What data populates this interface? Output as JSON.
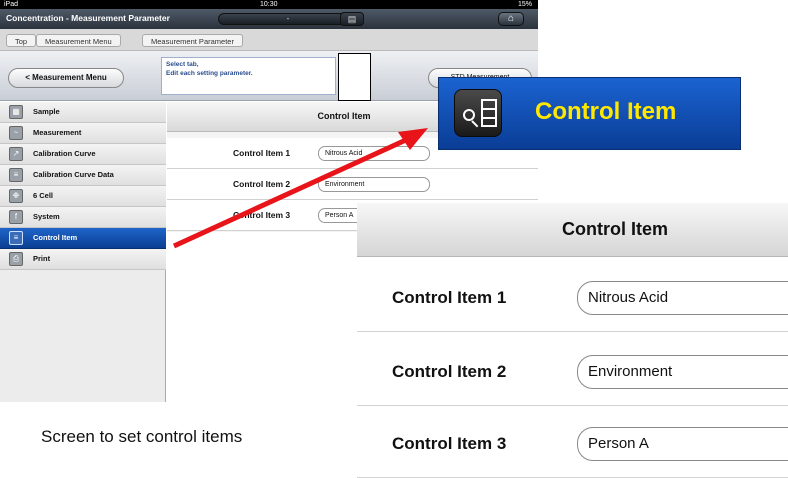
{
  "statusbar": {
    "device": "iPad",
    "time": "10:30",
    "battery": "15%"
  },
  "titlebar": {
    "title": "Concentration - Measurement Parameter",
    "center_label": "-"
  },
  "breadcrumb": [
    "Top",
    "Measurement Menu",
    "Measurement Parameter"
  ],
  "toolbar": {
    "back_label": "< Measurement Menu",
    "message_line1": "Select tab,",
    "message_line2": "Edit each setting parameter.",
    "right_button_label": "STD Measurement"
  },
  "sidebar": {
    "items": [
      {
        "label": "Sample",
        "icon": "sample-icon",
        "selected": false
      },
      {
        "label": "Measurement",
        "icon": "measurement-icon",
        "selected": false
      },
      {
        "label": "Calibration Curve",
        "icon": "calibration-curve-icon",
        "selected": false
      },
      {
        "label": "Calibration Curve Data",
        "icon": "calibration-data-icon",
        "selected": false
      },
      {
        "label": "6 Cell",
        "icon": "cell-icon",
        "selected": false
      },
      {
        "label": "System",
        "icon": "system-icon",
        "selected": false
      },
      {
        "label": "Control Item",
        "icon": "control-item-icon",
        "selected": true
      },
      {
        "label": "Print",
        "icon": "print-icon",
        "selected": false
      }
    ]
  },
  "content": {
    "header": "Control Item",
    "rows": [
      {
        "label": "Control Item 1",
        "value": "Nitrous Acid"
      },
      {
        "label": "Control Item 2",
        "value": "Environment"
      },
      {
        "label": "Control Item 3",
        "value": "Person A"
      }
    ]
  },
  "zoom_tab": {
    "label": "Control Item",
    "icon": "control-item-icon"
  },
  "zoom_panel": {
    "header": "Control Item",
    "rows": [
      {
        "label": "Control Item 1",
        "value": "Nitrous Acid"
      },
      {
        "label": "Control Item 2",
        "value": "Environment"
      },
      {
        "label": "Control Item 3",
        "value": "Person A"
      }
    ]
  },
  "caption": "Screen to set control items",
  "colors": {
    "accent_blue": "#0b3f93",
    "zoom_text": "#ffe800",
    "arrow": "#e8141a"
  }
}
